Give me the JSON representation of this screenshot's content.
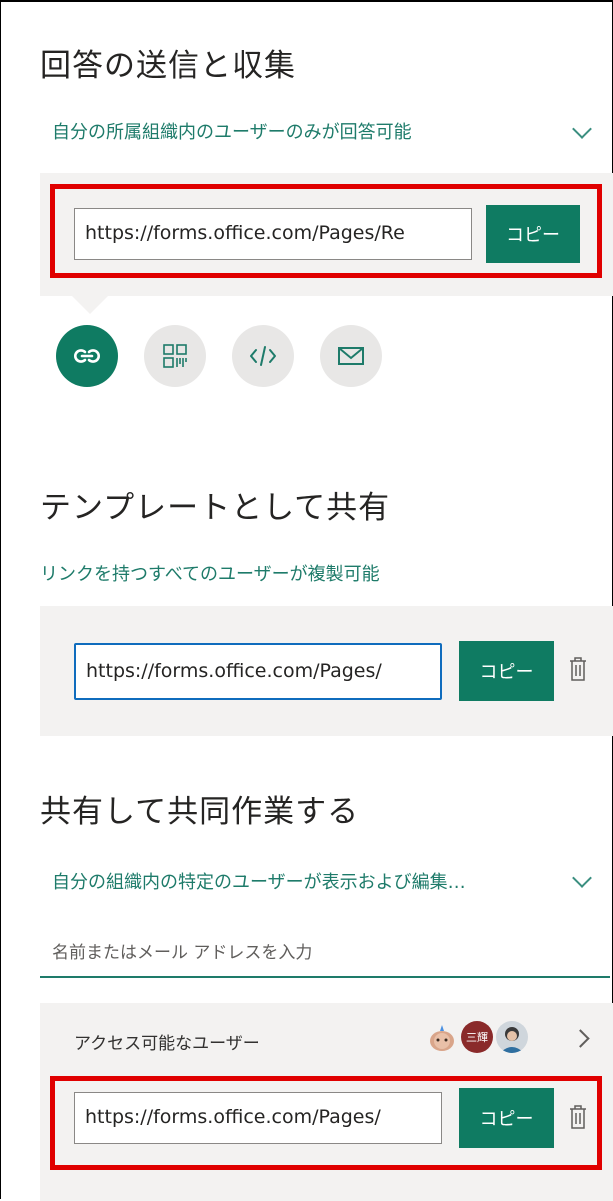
{
  "collect": {
    "title": "回答の送信と収集",
    "permission": "自分の所属組織内のユーザーのみが回答可能",
    "url": "https://forms.office.com/Pages/Re",
    "copy_label": "コピー",
    "share_methods": [
      {
        "icon": "link-icon",
        "active": true
      },
      {
        "icon": "qr-code-icon",
        "active": false
      },
      {
        "icon": "embed-code-icon",
        "active": false
      },
      {
        "icon": "mail-icon",
        "active": false
      }
    ]
  },
  "template": {
    "title": "テンプレートとして共有",
    "permission": "リンクを持つすべてのユーザーが複製可能",
    "url": "https://forms.office.com/Pages/",
    "copy_label": "コピー"
  },
  "collaborate": {
    "title": "共有して共同作業する",
    "permission": "自分の組織内の特定のユーザーが表示および編集…",
    "name_placeholder": "名前またはメール アドレスを入力",
    "access_label": "アクセス可能なユーザー",
    "avatar_badge": "三輝",
    "url": "https://forms.office.com/Pages/",
    "copy_label": "コピー"
  },
  "colors": {
    "accent": "#0f7b62",
    "link_text": "#1e7b6a",
    "highlight": "#e00000",
    "focus": "#0f6cbd"
  }
}
